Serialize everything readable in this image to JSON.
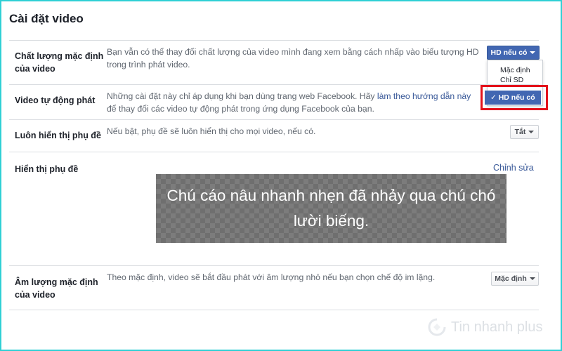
{
  "page": {
    "title": "Cài đặt video"
  },
  "rows": {
    "quality": {
      "label": "Chất lượng mặc định của video",
      "description": "Bạn vẫn có thể thay đổi chất lượng của video mình đang xem bằng cách nhấp vào biểu tượng HD trong trình phát video.",
      "select_value": "HD nếu có",
      "options": [
        "Mặc định",
        "Chỉ SD",
        "HD nếu có"
      ],
      "selected_option": "HD nếu có"
    },
    "autoplay": {
      "label": "Video tự động phát",
      "description_before": "Những cài đặt này chỉ áp dụng khi bạn dùng trang web Facebook. Hãy ",
      "description_link": "làm theo hướng dẫn này",
      "description_after": " để thay đổi các video tự động phát trong ứng dụng Facebook của bạn."
    },
    "captions_always": {
      "label": "Luôn hiển thị phụ đề",
      "description": "Nếu bật, phụ đề sẽ luôn hiển thị cho mọi video, nếu có.",
      "select_value": "Tắt"
    },
    "caption_display": {
      "label": "Hiển thị phụ đề",
      "edit_label": "Chỉnh sửa",
      "preview_text": "Chú cáo nâu nhanh nhẹn đã nhảy qua chú chó lười biếng."
    },
    "volume": {
      "label": "Âm lượng mặc định của video",
      "description": "Theo mặc định, video sẽ bắt đầu phát với âm lượng nhỏ nếu bạn chọn chế độ im lặng.",
      "select_value": "Mặc định"
    }
  },
  "watermark": {
    "text": "Tin nhanh plus",
    "icon": "tinnhanhplus-logo-icon"
  },
  "colors": {
    "accent": "#4267b2",
    "highlight": "#e3121b",
    "frame": "#2fd0d5",
    "link": "#385898"
  }
}
